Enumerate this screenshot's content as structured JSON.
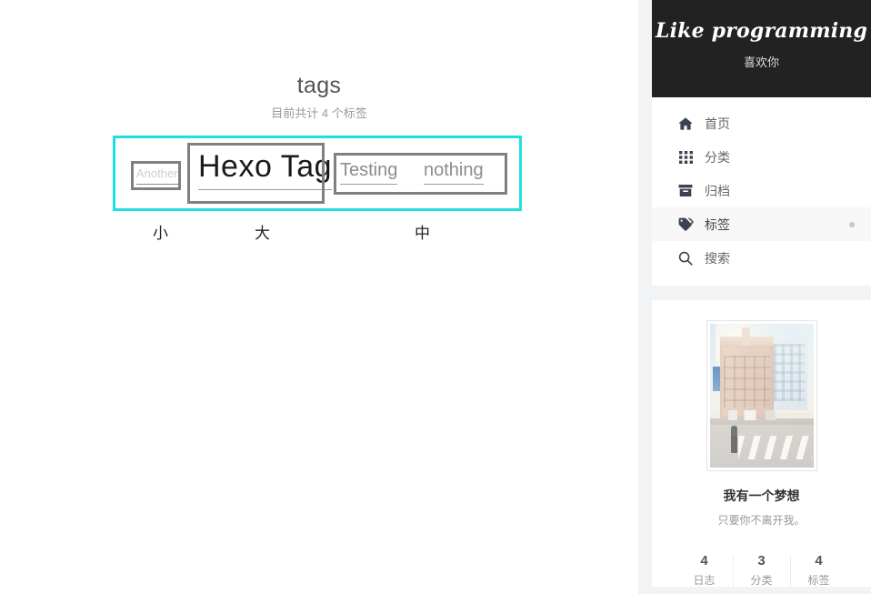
{
  "page": {
    "title": "tags",
    "subtitle": "目前共计 4 个标签"
  },
  "tag_cloud": {
    "tags": [
      {
        "name": "Another",
        "size": "small",
        "size_label": "小"
      },
      {
        "name": "Hexo Tag",
        "size": "large",
        "size_label": "大"
      },
      {
        "name": "Testing",
        "size": "medium",
        "size_label": "中"
      },
      {
        "name": "nothing",
        "size": "medium",
        "size_label": "中"
      }
    ],
    "size_labels": {
      "small": "小",
      "large": "大",
      "medium": "中"
    },
    "highlight_color": "#1fe0e0",
    "box_color": "#808080"
  },
  "sidebar": {
    "brand": {
      "title": "Like programming",
      "subtitle": "喜欢你"
    },
    "nav": [
      {
        "icon": "home-icon",
        "label": "首页",
        "active": false
      },
      {
        "icon": "grid-icon",
        "label": "分类",
        "active": false
      },
      {
        "icon": "archive-icon",
        "label": "归档",
        "active": false
      },
      {
        "icon": "tag-icon",
        "label": "标签",
        "active": true
      },
      {
        "icon": "search-icon",
        "label": "搜索",
        "active": false
      }
    ],
    "profile": {
      "name": "我有一个梦想",
      "motto": "只要你不离开我。",
      "avatar_alt": "street-photo"
    },
    "stats": [
      {
        "count": "4",
        "label": "日志"
      },
      {
        "count": "3",
        "label": "分类"
      },
      {
        "count": "4",
        "label": "标签"
      }
    ]
  }
}
